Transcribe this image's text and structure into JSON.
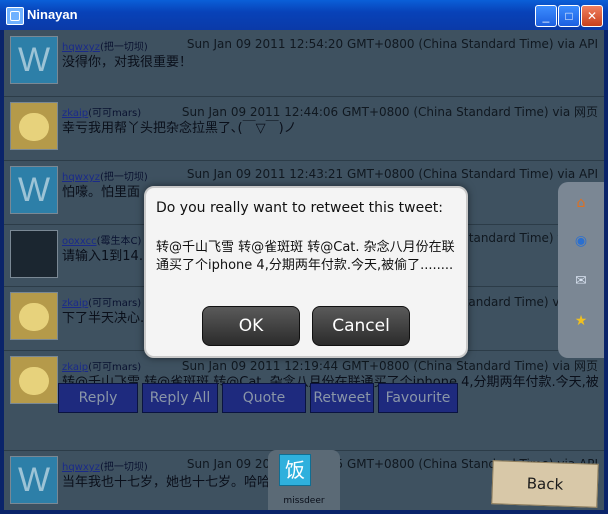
{
  "window": {
    "title": "Ninayan"
  },
  "tweets": [
    {
      "user": "hqwxyz",
      "user_suffix": "(把一切坝)",
      "meta": "Sun Jan 09 2011 12:54:20 GMT+0800 (China Standard Time) via API",
      "text": "没得你，对我很重要！"
    },
    {
      "user": "zkaip",
      "user_suffix": "(可可mars)",
      "meta": "Sun Jan 09 2011 12:44:06 GMT+0800 (China Standard Time) via 网页",
      "text": "幸亏我用帮丫头把杂念拉黑了､(￣▽￣)ノ"
    },
    {
      "user": "hqwxyz",
      "user_suffix": "(把一切坝)",
      "meta": "Sun Jan 09 2011 12:43:21 GMT+0800 (China Standard Time) via API",
      "text": "怕嚎。怕里面"
    },
    {
      "user": "ooxxcc",
      "user_suffix": "(霉生本C)",
      "meta": "Sun Jan 09 2011 12:3_:__ GMT+0800 (China Standard Time) via API",
      "text": "请输入1到14......"
    },
    {
      "user": "zkaip",
      "user_suffix": "(可可mars)",
      "meta": "Sun Jan 09 2011 12:2_:__ GMT+0800 (China Standard Time) via 网页",
      "text": "下了半天决心......所谓､(ﾟ∀ﾟ)ノ"
    },
    {
      "user": "zkaip",
      "user_suffix": "(可可mars)",
      "meta": "Sun Jan 09 2011 12:19:44 GMT+0800 (China Standard Time) via 网页",
      "text": "转@千山飞雪 转@雀斑斑 转@Cat. 杂念八月份在联通买了个iphone 4,分期两年付款.今天,被偷了........"
    },
    {
      "user": "hqwxyz",
      "user_suffix": "(把一切坝)",
      "meta": "Sun Jan 09 2011 12:16:15 GMT+0800 (China Standard Time) via API",
      "text": "当年我也十七岁，她也十七岁。哈哈"
    }
  ],
  "actions": {
    "reply": "Reply",
    "reply_all": "Reply All",
    "quote": "Quote",
    "retweet": "Retweet",
    "favourite": "Favourite"
  },
  "dock": {
    "icons": [
      "home-icon",
      "globe-icon",
      "mail-icon",
      "star-icon"
    ]
  },
  "current_user": {
    "name": "missdeer",
    "avatar_text": "饭"
  },
  "back_label": "Back",
  "dialog": {
    "title": "Do you really want to retweet this tweet:",
    "message": "转@千山飞雪 转@雀斑斑 转@Cat. 杂念八月份在联通买了个iphone 4,分期两年付款.今天,被偷了........",
    "ok_label": "OK",
    "cancel_label": "Cancel"
  }
}
